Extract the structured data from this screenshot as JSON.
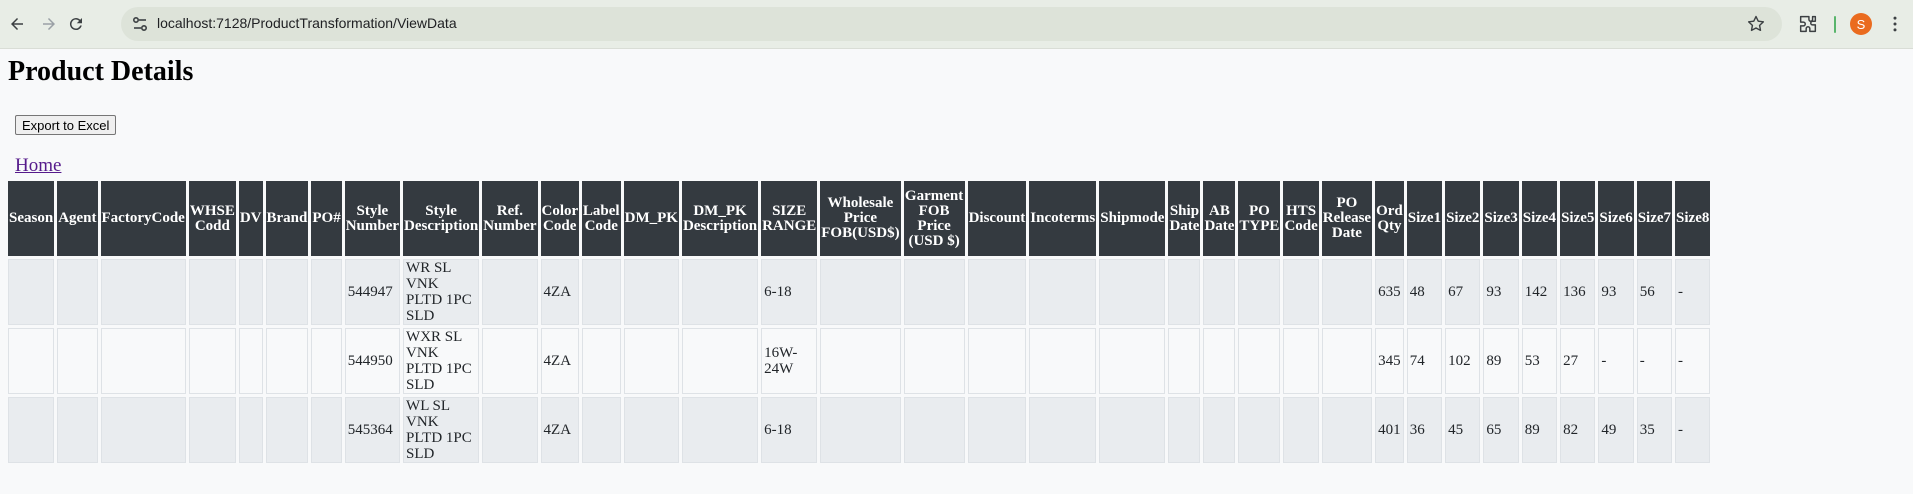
{
  "browser": {
    "url": "localhost:7128/ProductTransformation/ViewData",
    "avatar_letter": "S",
    "icons": [
      "back-arrow-icon",
      "forward-arrow-icon",
      "reload-icon",
      "site-info-icon",
      "bookmark-star-icon",
      "extensions-icon",
      "kebab-menu-icon"
    ]
  },
  "page": {
    "title": "Product Details",
    "export_label": "Export to Excel",
    "home_label": "Home"
  },
  "table": {
    "headers": [
      "Season",
      "Agent",
      "FactoryCode",
      "WHSE Codd",
      "DV",
      "Brand",
      "PO#",
      "Style Number",
      "Style Description",
      "Ref. Number",
      "Color Code",
      "Label Code",
      "DM_PK",
      "DM_PK Description",
      "SIZE RANGE",
      "Wholesale Price FOB(USD$)",
      "Garment FOB Price (USD $)",
      "Discount",
      "Incoterms",
      "Shipmode",
      "Ship Date",
      "AB Date",
      "PO TYPE",
      "HTS Code",
      "PO Release Date",
      "Ord Qty",
      "Size1",
      "Size2",
      "Size3",
      "Size4",
      "Size5",
      "Size6",
      "Size7",
      "Size8"
    ],
    "rows": [
      [
        "",
        "",
        "",
        "",
        "",
        "",
        "",
        "544947",
        "WR SL VNK PLTD 1PC SLD",
        "",
        "4ZA",
        "",
        "",
        "",
        "6-18",
        "",
        "",
        "",
        "",
        "",
        "",
        "",
        "",
        "",
        "",
        "635",
        "48",
        "67",
        "93",
        "142",
        "136",
        "93",
        "56",
        "-"
      ],
      [
        "",
        "",
        "",
        "",
        "",
        "",
        "",
        "544950",
        "WXR SL VNK PLTD 1PC SLD",
        "",
        "4ZA",
        "",
        "",
        "",
        "16W-24W",
        "",
        "",
        "",
        "",
        "",
        "",
        "",
        "",
        "",
        "",
        "345",
        "74",
        "102",
        "89",
        "53",
        "27",
        "-",
        "-",
        "-"
      ],
      [
        "",
        "",
        "",
        "",
        "",
        "",
        "",
        "545364",
        "WL SL VNK PLTD 1PC SLD",
        "",
        "4ZA",
        "",
        "",
        "",
        "6-18",
        "",
        "",
        "",
        "",
        "",
        "",
        "",
        "",
        "",
        "",
        "401",
        "36",
        "45",
        "65",
        "89",
        "82",
        "49",
        "35",
        "-"
      ]
    ]
  },
  "colors": {
    "header_bg": "#343a40",
    "header_text": "#ffffff",
    "row_odd": "#e9ecef",
    "row_even": "#f8f9fa",
    "link": "#551a8b",
    "avatar": "#ea6b1f"
  }
}
